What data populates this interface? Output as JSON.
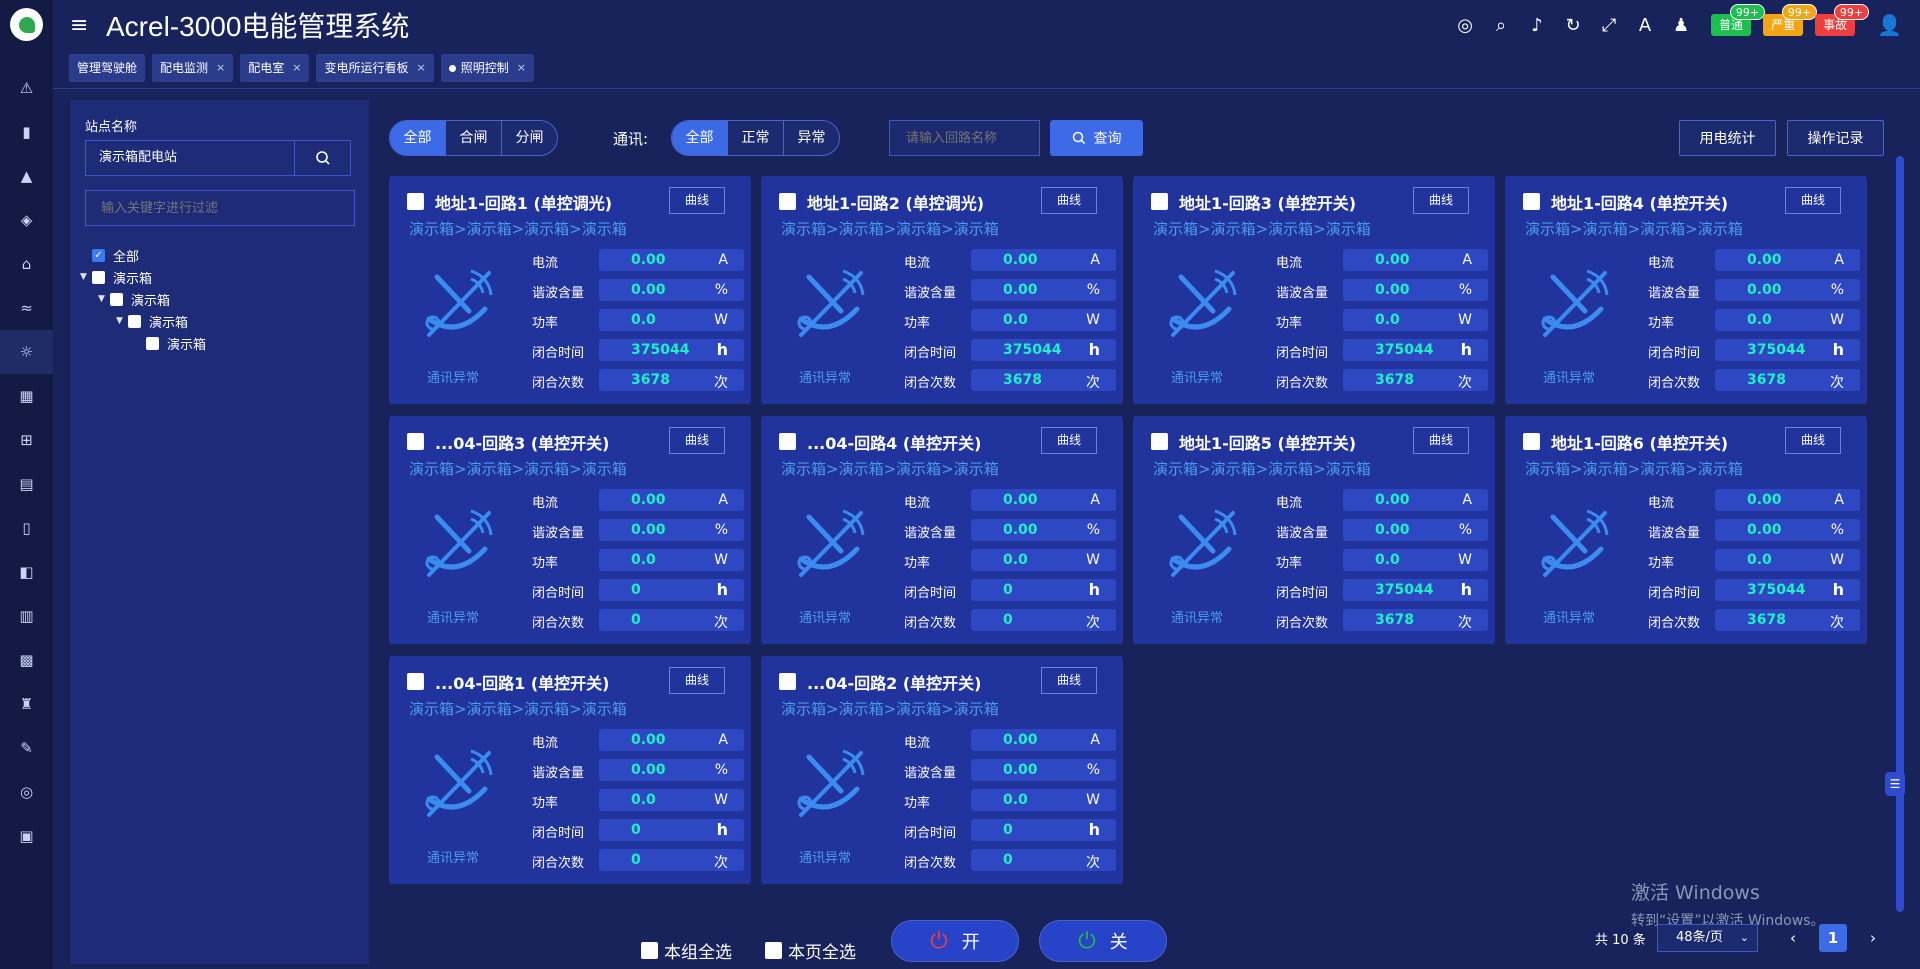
{
  "app": {
    "title": "Acrel-3000电能管理系统"
  },
  "header": {
    "icons": [
      "globe-icon",
      "search-icon",
      "volume-icon",
      "refresh-icon",
      "fullscreen-icon",
      "translate-icon",
      "theme-icon"
    ],
    "alarms": [
      {
        "label": "普通",
        "count": "99+",
        "color": "#1dbf4f",
        "badge_color": "#1dbf4f"
      },
      {
        "label": "严重",
        "count": "99+",
        "color": "#f3a514",
        "badge_color": "#f3a514"
      },
      {
        "label": "事故",
        "count": "99+",
        "color": "#ef3e3e",
        "badge_color": "#ef3e3e"
      }
    ]
  },
  "tabs": [
    {
      "label": "管理驾驶舱",
      "closable": false,
      "active": false
    },
    {
      "label": "配电监测",
      "closable": true,
      "active": false
    },
    {
      "label": "配电室",
      "closable": true,
      "active": false
    },
    {
      "label": "变电所运行看板",
      "closable": true,
      "active": false
    },
    {
      "label": "照明控制",
      "closable": true,
      "active": true
    }
  ],
  "close_mark": "×",
  "tree": {
    "station_label": "站点名称",
    "station_value": "演示箱配电站",
    "filter_placeholder": "输入关键字进行过滤",
    "nodes": [
      {
        "label": "全部",
        "checked": true
      },
      {
        "label": "演示箱",
        "checked": false
      },
      {
        "label": "演示箱",
        "checked": false
      },
      {
        "label": "演示箱",
        "checked": false
      },
      {
        "label": "演示箱",
        "checked": false
      }
    ]
  },
  "toolbar": {
    "state_group": [
      "全部",
      "合闸",
      "分闸"
    ],
    "comm_label": "通讯:",
    "comm_group": [
      "全部",
      "正常",
      "异常"
    ],
    "search_placeholder": "请输入回路名称",
    "query_label": "查询",
    "stats_label": "用电统计",
    "log_label": "操作记录"
  },
  "card_common": {
    "curve_label": "曲线",
    "path": "演示箱>演示箱>演示箱>演示箱",
    "status": "通讯异常",
    "labels": [
      "电流",
      "谐波含量",
      "功率",
      "闭合时间",
      "闭合次数"
    ],
    "units": [
      "A",
      "%",
      "W",
      "h",
      "次"
    ]
  },
  "cards": [
    {
      "title": "地址1-回路1 (单控调光)",
      "values": [
        "0.00",
        "0.00",
        "0.0",
        "375044",
        "3678"
      ]
    },
    {
      "title": "地址1-回路2 (单控调光)",
      "values": [
        "0.00",
        "0.00",
        "0.0",
        "375044",
        "3678"
      ]
    },
    {
      "title": "地址1-回路3 (单控开关)",
      "values": [
        "0.00",
        "0.00",
        "0.0",
        "375044",
        "3678"
      ]
    },
    {
      "title": "地址1-回路4 (单控开关)",
      "values": [
        "0.00",
        "0.00",
        "0.0",
        "375044",
        "3678"
      ]
    },
    {
      "title": "...04-回路3 (单控开关)",
      "values": [
        "0.00",
        "0.00",
        "0.0",
        "0",
        "0"
      ]
    },
    {
      "title": "...04-回路4 (单控开关)",
      "values": [
        "0.00",
        "0.00",
        "0.0",
        "0",
        "0"
      ]
    },
    {
      "title": "地址1-回路5 (单控开关)",
      "values": [
        "0.00",
        "0.00",
        "0.0",
        "375044",
        "3678"
      ]
    },
    {
      "title": "地址1-回路6 (单控开关)",
      "values": [
        "0.00",
        "0.00",
        "0.0",
        "375044",
        "3678"
      ]
    },
    {
      "title": "...04-回路1 (单控开关)",
      "values": [
        "0.00",
        "0.00",
        "0.0",
        "0",
        "0"
      ]
    },
    {
      "title": "...04-回路2 (单控开关)",
      "values": [
        "0.00",
        "0.00",
        "0.0",
        "0",
        "0"
      ]
    }
  ],
  "bottom": {
    "select_group": "本组全选",
    "select_page": "本页全选",
    "on_label": "开",
    "off_label": "关"
  },
  "pagination": {
    "total": "共 10 条",
    "page_size": "48条/页",
    "prev": "‹",
    "next": "›",
    "current": "1"
  },
  "watermark": {
    "line1": "激活 Windows",
    "line2": "转到“设置”以激活 Windows。"
  },
  "colors": {
    "background": "#17235a",
    "sidebar": "#131b45",
    "panel": "#1e2c78",
    "card": "#21339c",
    "accent": "#3d6be8",
    "value": "#1ef1c6",
    "link": "#4b9bf0",
    "power_on": "#ef3e3e",
    "power_off": "#1dbf4f"
  }
}
